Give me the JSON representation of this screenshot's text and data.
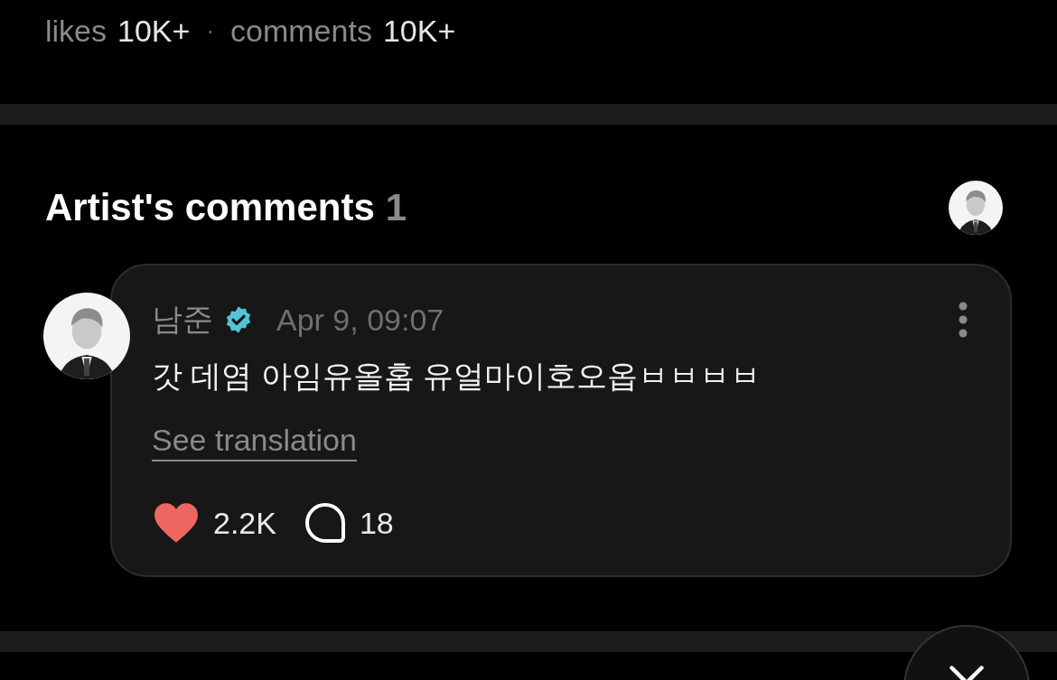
{
  "stats": [
    {
      "label": "likes",
      "value": "10K+"
    },
    {
      "label": "comments",
      "value": "10K+"
    }
  ],
  "stats_separator": "·",
  "section": {
    "title": "Artist's comments",
    "count": "1"
  },
  "comment": {
    "author": "남준",
    "verified": true,
    "time": "Apr 9, 09:07",
    "text": "갓 데염 아임유올홉 유얼마이호오옵ㅂㅂㅂㅂ",
    "translate_link": "See translation",
    "liked": true,
    "likes": "2.2K",
    "replies": "18"
  }
}
